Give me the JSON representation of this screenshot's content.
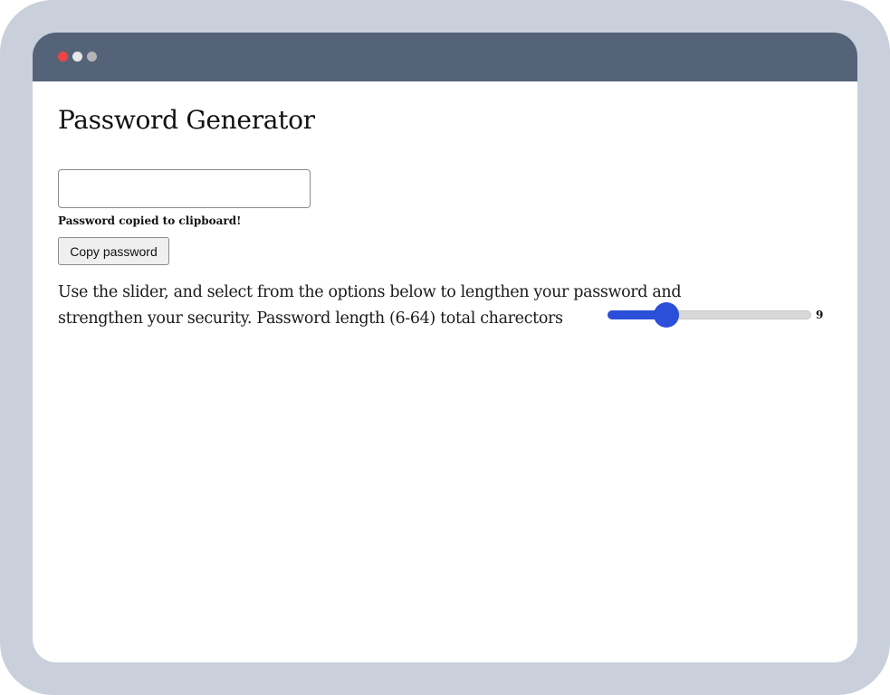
{
  "window": {
    "controls": [
      "close",
      "minimize",
      "zoom"
    ]
  },
  "app": {
    "title": "Password Generator"
  },
  "password_field": {
    "value": "",
    "placeholder": ""
  },
  "status": {
    "message": "Password copied to clipboard!"
  },
  "buttons": {
    "copy_label": "Copy password"
  },
  "instructions": {
    "text": "Use the slider, and select from the options below to lengthen your password and strengthen your security. Password length (6-64) total charectors"
  },
  "length_slider": {
    "min": 6,
    "max": 64,
    "value": 9,
    "display_value": "9",
    "fill_fraction": 0.29
  },
  "colors": {
    "frame": "#c9d0dc",
    "titlebar": "#546378",
    "accent": "#2b4fd8",
    "close_dot": "#ef4444"
  }
}
